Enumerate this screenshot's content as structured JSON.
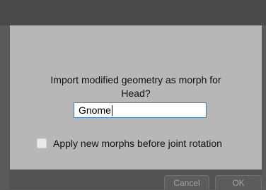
{
  "dialog": {
    "message_line1": "Import modified geometry as morph for",
    "message_line2": "Head?",
    "name_input_value": "Gnome",
    "checkbox_label": "Apply new morphs before joint rotation",
    "checkbox_checked": false,
    "cancel_label": "Cancel",
    "ok_label": "OK"
  }
}
